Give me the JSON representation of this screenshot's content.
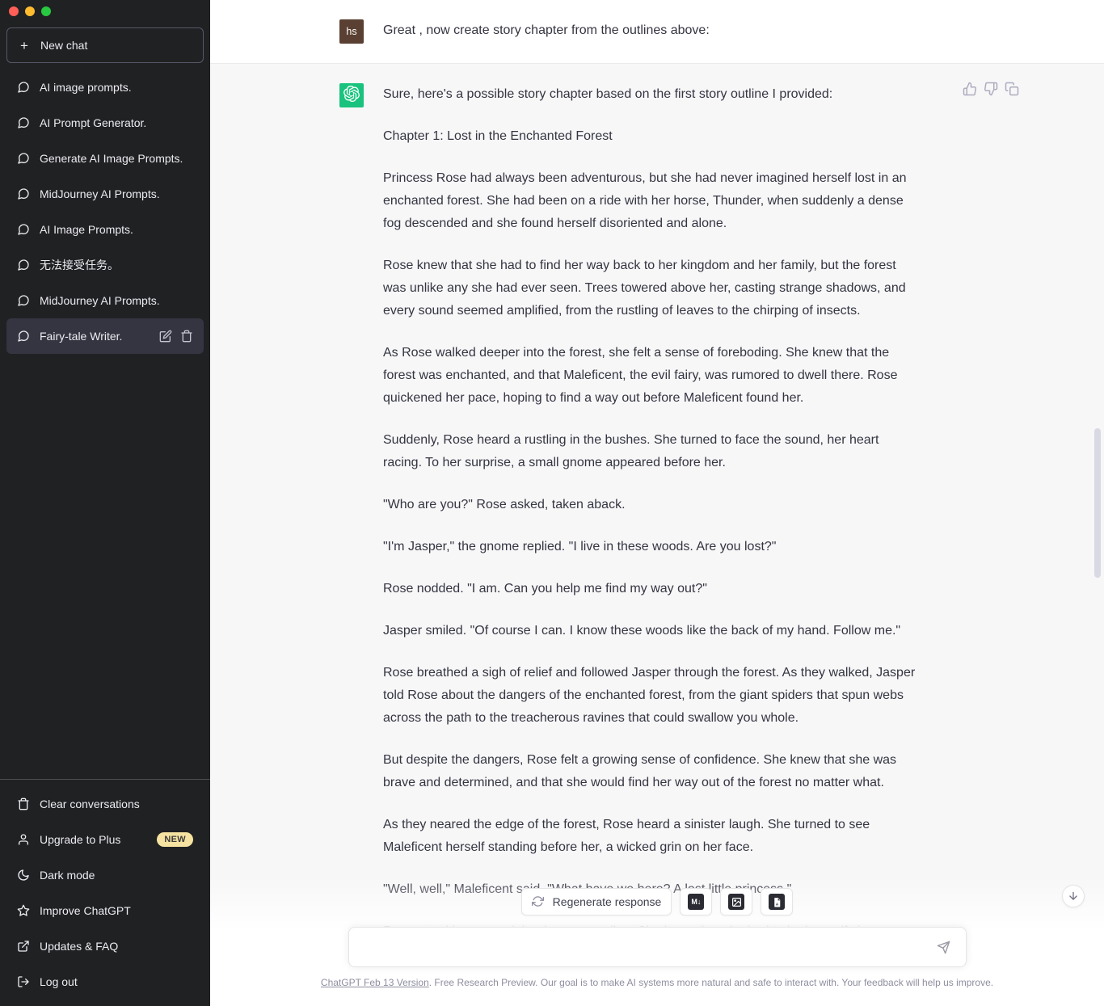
{
  "window": {
    "traffic_lights": [
      "close",
      "minimize",
      "zoom"
    ]
  },
  "sidebar": {
    "new_chat_label": "New chat",
    "new_chat_icon": "plus-icon",
    "conversations": [
      {
        "label": "AI image prompts.",
        "icon": "message-icon",
        "active": false
      },
      {
        "label": "AI Prompt Generator.",
        "icon": "message-icon",
        "active": false
      },
      {
        "label": "Generate AI Image Prompts.",
        "icon": "message-icon",
        "active": false
      },
      {
        "label": "MidJourney AI Prompts.",
        "icon": "message-icon",
        "active": false
      },
      {
        "label": "AI Image Prompts.",
        "icon": "message-icon",
        "active": false
      },
      {
        "label": "无法接受任务。",
        "icon": "message-icon",
        "active": false
      },
      {
        "label": "MidJourney AI Prompts.",
        "icon": "message-icon",
        "active": false
      },
      {
        "label": "Fairy-tale Writer.",
        "icon": "message-icon",
        "active": true
      }
    ],
    "active_item_actions": [
      "edit-icon",
      "trash-icon"
    ],
    "footer_items": [
      {
        "label": "Clear conversations",
        "icon": "trash-icon",
        "badge": ""
      },
      {
        "label": "Upgrade to Plus",
        "icon": "user-icon",
        "badge": "NEW"
      },
      {
        "label": "Dark mode",
        "icon": "moon-icon",
        "badge": ""
      },
      {
        "label": "Improve ChatGPT",
        "icon": "star-icon",
        "badge": ""
      },
      {
        "label": "Updates & FAQ",
        "icon": "external-link-icon",
        "badge": ""
      },
      {
        "label": "Log out",
        "icon": "logout-icon",
        "badge": ""
      }
    ]
  },
  "conversation": {
    "user_message": {
      "avatar_initials": "hs",
      "text": "Great , now create story chapter from the outlines above:"
    },
    "assistant_message": {
      "avatar_icon": "openai-logo-icon",
      "actions": [
        "thumbs-up-icon",
        "thumbs-down-icon",
        "copy-icon"
      ],
      "paragraphs": [
        "Sure, here's a possible story chapter based on the first story outline I provided:",
        "Chapter 1: Lost in the Enchanted Forest",
        "Princess Rose had always been adventurous, but she had never imagined herself lost in an enchanted forest. She had been on a ride with her horse, Thunder, when suddenly a dense fog descended and she found herself disoriented and alone.",
        "Rose knew that she had to find her way back to her kingdom and her family, but the forest was unlike any she had ever seen. Trees towered above her, casting strange shadows, and every sound seemed amplified, from the rustling of leaves to the chirping of insects.",
        "As Rose walked deeper into the forest, she felt a sense of foreboding. She knew that the forest was enchanted, and that Maleficent, the evil fairy, was rumored to dwell there. Rose quickened her pace, hoping to find a way out before Maleficent found her.",
        "Suddenly, Rose heard a rustling in the bushes. She turned to face the sound, her heart racing. To her surprise, a small gnome appeared before her.",
        "\"Who are you?\" Rose asked, taken aback.",
        "\"I'm Jasper,\" the gnome replied. \"I live in these woods. Are you lost?\"",
        "Rose nodded. \"I am. Can you help me find my way out?\"",
        "Jasper smiled. \"Of course I can. I know these woods like the back of my hand. Follow me.\"",
        "Rose breathed a sigh of relief and followed Jasper through the forest. As they walked, Jasper told Rose about the dangers of the enchanted forest, from the giant spiders that spun webs across the path to the treacherous ravines that could swallow you whole.",
        "But despite the dangers, Rose felt a growing sense of confidence. She knew that she was brave and determined, and that she would find her way out of the forest no matter what.",
        "As they neared the edge of the forest, Rose heard a sinister laugh. She turned to see Maleficent herself standing before her, a wicked grin on her face.",
        "\"Well, well,\" Maleficent said. \"What have we here? A lost little princess.\"",
        "Rose stood her ground, her heart pounding. She knew that she had to be brave if she was"
      ]
    }
  },
  "toolbar": {
    "regenerate_label": "Regenerate response",
    "regenerate_icon": "refresh-icon",
    "export_buttons": [
      {
        "name": "export-markdown-button",
        "glyph": "M↓"
      },
      {
        "name": "export-image-button",
        "glyph": "image"
      },
      {
        "name": "export-pdf-button",
        "glyph": "pdf"
      }
    ]
  },
  "composer": {
    "value": "",
    "placeholder": "",
    "send_icon": "send-icon",
    "scroll_bottom_icon": "arrow-down-icon"
  },
  "footer": {
    "version_link": "ChatGPT Feb 13 Version",
    "text": ". Free Research Preview. Our goal is to make AI systems more natural and safe to interact with. Your feedback will help us improve."
  },
  "colors": {
    "sidebar_bg": "#202123",
    "sidebar_active": "#343541",
    "assistant_row_bg": "#f7f7f8",
    "accent_green": "#19c37d",
    "user_avatar_brown": "#5a4032",
    "badge_yellow": "#f6e3a1"
  }
}
